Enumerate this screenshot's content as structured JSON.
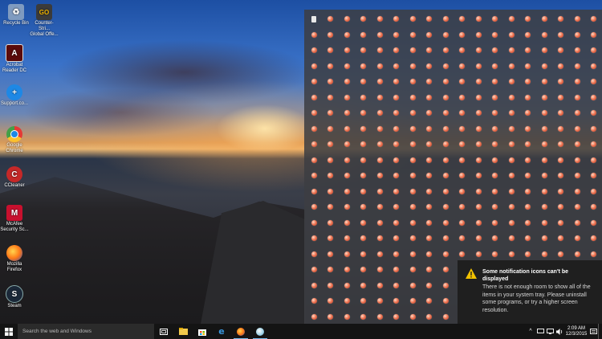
{
  "desktop": {
    "icons": [
      {
        "label": "Recycle Bin",
        "glyph": "♻",
        "color": "#9fb7d6",
        "icon_name": "recycle-bin-icon"
      },
      {
        "label": "Counter-Stri...\nGlobal Offe...",
        "glyph": "GO",
        "color": "#d9a400",
        "icon_name": "csgo-icon"
      },
      {
        "label": "Acrobat\nReader DC",
        "glyph": "A",
        "color": "#b30b00",
        "icon_name": "acrobat-icon"
      },
      {
        "label": "Support.co...",
        "glyph": "+",
        "color": "#1e88e5",
        "icon_name": "support-icon"
      },
      {
        "label": "Google\nChrome",
        "glyph": "●",
        "color": "#e53935",
        "icon_name": "chrome-icon"
      },
      {
        "label": "CCleaner",
        "glyph": "C",
        "color": "#c62828",
        "icon_name": "ccleaner-icon"
      },
      {
        "label": "McAfee\nSecurity Sc...",
        "glyph": "M",
        "color": "#c8102e",
        "icon_name": "mcafee-icon"
      },
      {
        "label": "Mozilla\nFirefox",
        "glyph": "●",
        "color": "#ff7a18",
        "icon_name": "firefox-icon"
      },
      {
        "label": "Steam",
        "glyph": "S",
        "color": "#1b2838",
        "icon_name": "steam-icon"
      }
    ]
  },
  "notification": {
    "title": "Some notification icons can't be displayed",
    "body": "There is not enough room to show all of the items in your system tray. Please uninstall some programs, or try a higher screen resolution."
  },
  "taskbar": {
    "search_placeholder": "Search the web and Windows",
    "time": "2:09 AM",
    "date": "12/3/2015"
  },
  "tray_overflow": {
    "columns": 18,
    "rows": 20,
    "icon_name": "tray-app-icon"
  },
  "colors": {
    "taskbar": "#141414",
    "tray_panel": "#3c3e42",
    "notification": "#1f1f1f",
    "accent": "#76b9ed"
  }
}
